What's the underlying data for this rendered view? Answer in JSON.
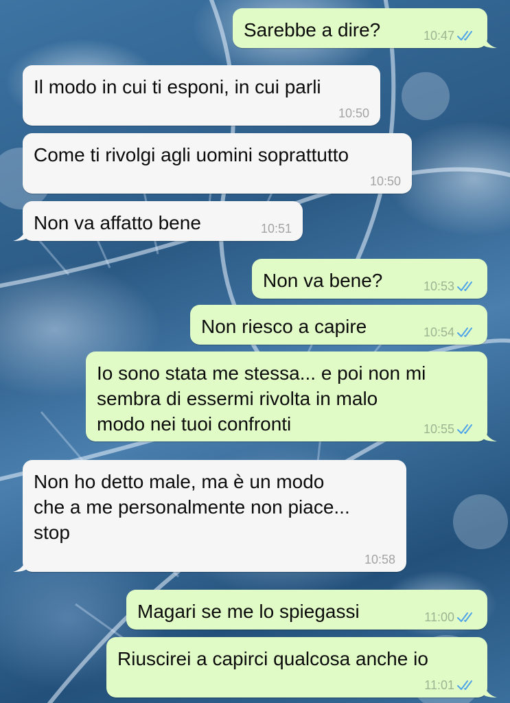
{
  "chat": {
    "messages": [
      {
        "direction": "out",
        "text": "Sarebbe a dire?",
        "time": "10:47",
        "read": true
      },
      {
        "direction": "in",
        "text": "Il modo in cui ti esponi, in cui parli",
        "time": "10:50"
      },
      {
        "direction": "in",
        "text": "Come ti rivolgi agli uomini soprattutto",
        "time": "10:50"
      },
      {
        "direction": "in",
        "text": "Non va affatto bene",
        "time": "10:51"
      },
      {
        "direction": "out",
        "text": "Non va bene?",
        "time": "10:53",
        "read": true
      },
      {
        "direction": "out",
        "text": "Non riesco a capire",
        "time": "10:54",
        "read": true
      },
      {
        "direction": "out",
        "text": "Io sono stata me stessa... e poi non mi\nsembra di essermi rivolta in malo\nmodo nei tuoi confronti",
        "time": "10:55",
        "read": true
      },
      {
        "direction": "in",
        "text": "Non ho detto male, ma è un modo\nche a me personalmente non piace...\nstop",
        "time": "10:58"
      },
      {
        "direction": "out",
        "text": "Magari se me lo spiegassi",
        "time": "11:00",
        "read": true
      },
      {
        "direction": "out",
        "text": "Riuscirei a capirci qualcosa anche io",
        "time": "11:01",
        "read": true
      }
    ]
  },
  "colors": {
    "incoming_bubble": "#f6f6f6",
    "outgoing_bubble": "#e1fbc6",
    "read_ticks": "#4fa3e8"
  },
  "icons": {
    "read_receipt": "double-check-icon",
    "wallpaper": "frost-leaf-wallpaper"
  }
}
